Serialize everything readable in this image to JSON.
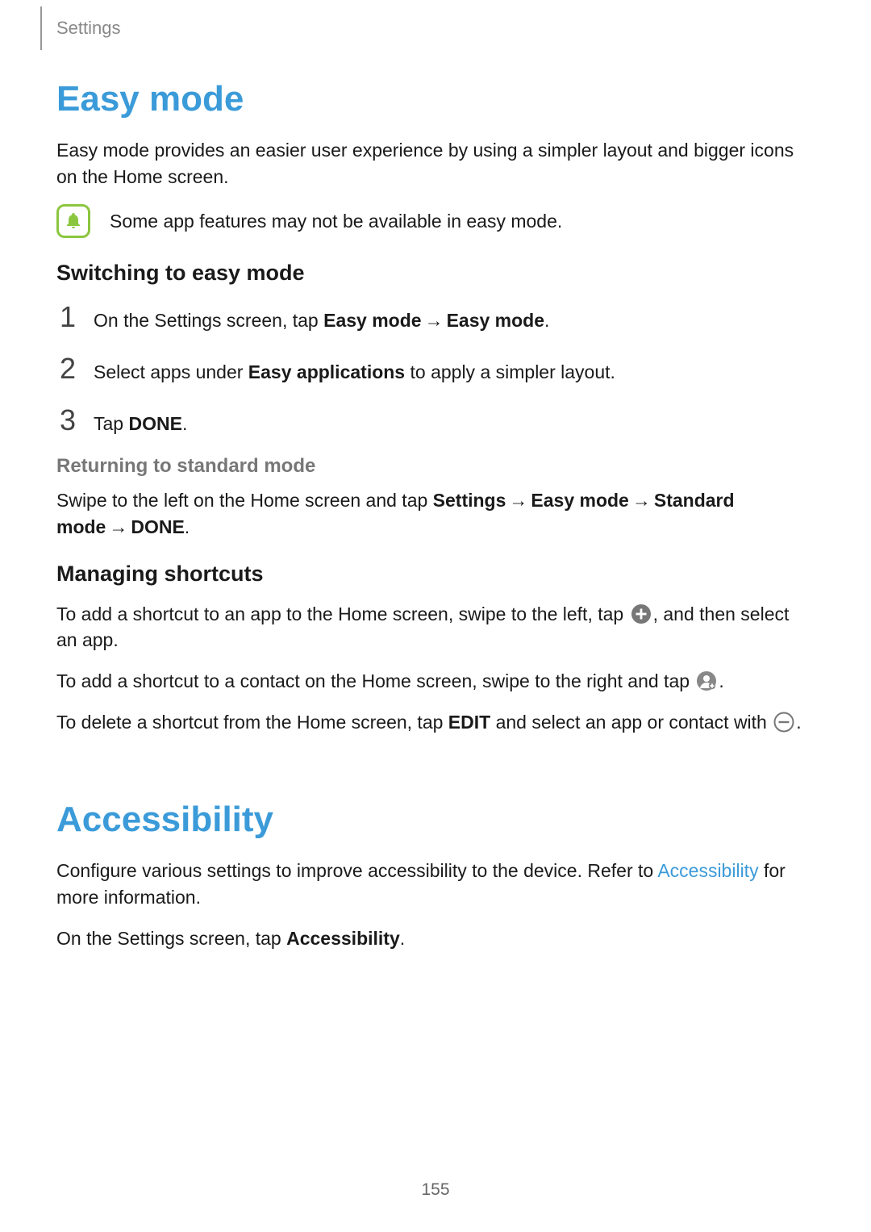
{
  "breadcrumb": "Settings",
  "pageNumber": "155",
  "arrow": "→",
  "easyMode": {
    "heading": "Easy mode",
    "intro": "Easy mode provides an easier user experience by using a simpler layout and bigger icons on the Home screen.",
    "note": "Some app features may not be available in easy mode.",
    "switching": {
      "heading": "Switching to easy mode",
      "steps": {
        "n1": "1",
        "n2": "2",
        "n3": "3",
        "s1_a": "On the Settings screen, tap ",
        "s1_b1": "Easy mode",
        "s1_b2": "Easy mode",
        "s1_c": ".",
        "s2_a": "Select apps under ",
        "s2_b": "Easy applications",
        "s2_c": " to apply a simpler layout.",
        "s3_a": "Tap ",
        "s3_b": "DONE",
        "s3_c": "."
      }
    },
    "returning": {
      "heading": "Returning to standard mode",
      "t_a": "Swipe to the left on the Home screen and tap ",
      "b1": "Settings",
      "b2": "Easy mode",
      "b3": "Standard mode",
      "b4": "DONE",
      "t_end": "."
    },
    "managing": {
      "heading": "Managing shortcuts",
      "p1_a": "To add a shortcut to an app to the Home screen, swipe to the left, tap ",
      "p1_b": ", and then select an app.",
      "p2_a": "To add a shortcut to a contact on the Home screen, swipe to the right and tap ",
      "p2_b": ".",
      "p3_a": "To delete a shortcut from the Home screen, tap ",
      "p3_bold": "EDIT",
      "p3_b": " and select an app or contact with ",
      "p3_c": "."
    }
  },
  "accessibility": {
    "heading": "Accessibility",
    "p1_a": "Configure various settings to improve accessibility to the device. Refer to ",
    "p1_link": "Accessibility",
    "p1_b": " for more information.",
    "p2_a": "On the Settings screen, tap ",
    "p2_bold": "Accessibility",
    "p2_b": "."
  }
}
